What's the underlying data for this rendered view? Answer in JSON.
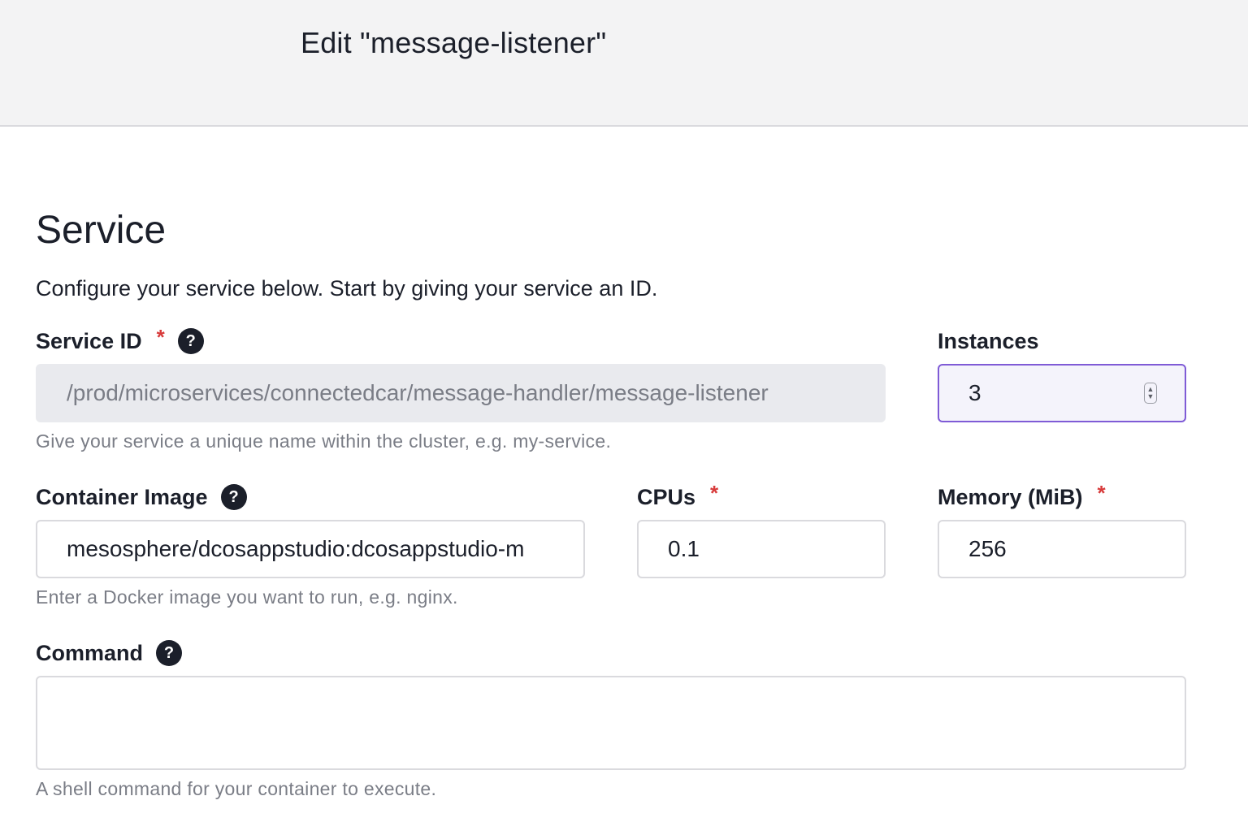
{
  "header": {
    "title": "Edit \"message-listener\""
  },
  "section": {
    "title": "Service",
    "intro": "Configure your service below. Start by giving your service an ID."
  },
  "service_id": {
    "label": "Service ID",
    "required_mark": "*",
    "help_glyph": "?",
    "value": "/prod/microservices/connectedcar/message-handler/message-listener",
    "hint": "Give your service a unique name within the cluster, e.g. my-service."
  },
  "instances": {
    "label": "Instances",
    "value": "3"
  },
  "container_image": {
    "label": "Container Image",
    "help_glyph": "?",
    "value": "mesosphere/dcosappstudio:dcosappstudio-m",
    "hint": "Enter a Docker image you want to run, e.g. nginx."
  },
  "cpus": {
    "label": "CPUs",
    "required_mark": "*",
    "value": "0.1"
  },
  "memory": {
    "label": "Memory (MiB)",
    "required_mark": "*",
    "value": "256"
  },
  "command": {
    "label": "Command",
    "help_glyph": "?",
    "value": "",
    "hint": "A shell command for your container to execute."
  },
  "colors": {
    "header_bg": "#f3f3f4",
    "required": "#d83b3b",
    "focus_border": "#7f5bd6",
    "disabled_bg": "#e9eaee",
    "text": "#1b1f2a",
    "hint_text": "#7a7d86"
  },
  "icons": {
    "help": "question-circle-icon",
    "stepper": "number-stepper-icon"
  }
}
